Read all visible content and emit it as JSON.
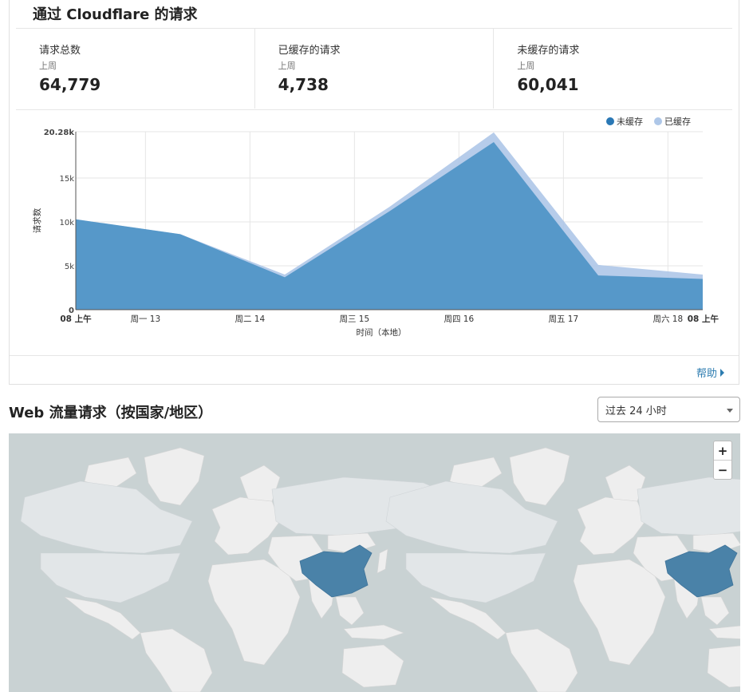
{
  "card": {
    "title": "通过 Cloudflare 的请求",
    "help_label": "帮助"
  },
  "stats": [
    {
      "label": "请求总数",
      "period": "上周",
      "value": "64,779"
    },
    {
      "label": "已缓存的请求",
      "period": "上周",
      "value": "4,738"
    },
    {
      "label": "未缓存的请求",
      "period": "上周",
      "value": "60,041"
    }
  ],
  "chart_data": {
    "type": "area",
    "stacked": true,
    "xlabel": "时间（本地）",
    "ylabel": "请求数",
    "y_ticks": [
      "0",
      "5k",
      "10k",
      "15k",
      "20.28k"
    ],
    "y_tick_values": [
      0,
      5000,
      10000,
      15000,
      20280
    ],
    "ylim": [
      0,
      20280
    ],
    "x_ticks": [
      "08 上午",
      "周一 13",
      "周二 14",
      "周三 15",
      "周四 16",
      "周五 17",
      "周六 18",
      "08 上午"
    ],
    "x_tick_hours": [
      0,
      16,
      40,
      64,
      88,
      112,
      136,
      144
    ],
    "x_hours": [
      0,
      24,
      48,
      72,
      96,
      120,
      144
    ],
    "series": [
      {
        "name": "未缓存",
        "color": "#3e8bc1",
        "values": [
          10300,
          8600,
          3700,
          11200,
          19100,
          3900,
          3500
        ]
      },
      {
        "name": "已缓存",
        "color": "#aec7e8",
        "values": [
          0,
          0,
          300,
          500,
          1100,
          1200,
          500
        ]
      }
    ],
    "legend_position": "top-right",
    "grid": true
  },
  "traffic": {
    "title": "Web 流量请求（按国家/地区）",
    "range_select": "过去 24 小时",
    "zoom_in": "+",
    "zoom_out": "−",
    "highlight_country": "China",
    "highlight_color": "#4a82a8"
  }
}
